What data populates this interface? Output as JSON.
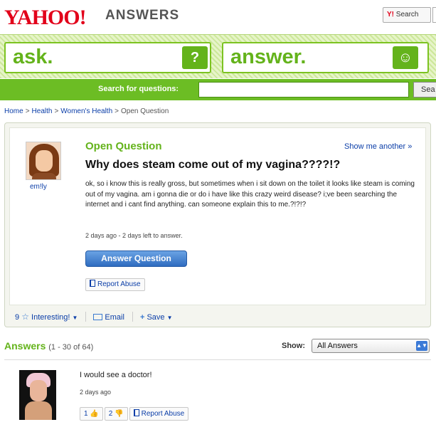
{
  "header": {
    "logo": "YAHOO!",
    "logo_sub": "ANSWERS",
    "search_brand": "Y!",
    "search_label": "Search"
  },
  "band": {
    "ask": "ask.",
    "ask_icon": "?",
    "answer": "answer.",
    "answer_icon": "☺"
  },
  "search": {
    "label": "Search for questions:",
    "placeholder": "",
    "button": "Sea"
  },
  "breadcrumb": {
    "home": "Home",
    "health": "Health",
    "womens": "Women's Health",
    "current": "Open Question",
    "sep": ">"
  },
  "question": {
    "type": "Open Question",
    "show_another": "Show me another »",
    "asker": "em!ly",
    "title": "Why does steam come out of my vagina????!?",
    "body": "ok, so i know this is really gross, but sometimes when i sit down on the toilet it looks like steam is coming out of my vagina. am i gonna die or do i have like this crazy weird disease? i;ve been searching the internet and i cant find anything. can someone explain this to me.?!?!?",
    "meta": "2 days ago - 2 days left to answer.",
    "answer_button": "Answer Question",
    "report": "Report Abuse",
    "interesting_count": "9",
    "interesting": "Interesting!",
    "email": "Email",
    "save": "Save"
  },
  "answers": {
    "title": "Answers",
    "count": "(1 - 30 of 64)",
    "show_label": "Show:",
    "show_value": "All Answers",
    "items": [
      {
        "text": "I would see a doctor!",
        "meta": "2 days ago",
        "thumbs_up": "1",
        "thumbs_down": "2",
        "report": "Report Abuse"
      }
    ]
  },
  "colors": {
    "yahoo_red": "#e2001a",
    "answers_green": "#64b31b",
    "strip_green": "#6cbd24",
    "link_blue": "#0b3ea8",
    "button_blue": "#2f6cc0"
  }
}
